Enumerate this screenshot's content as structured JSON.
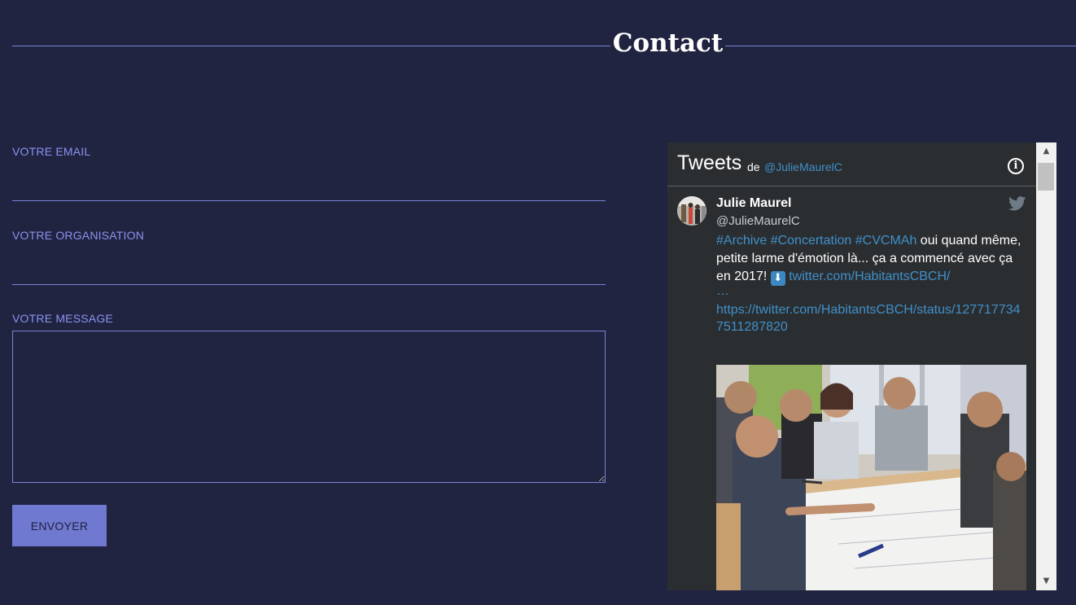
{
  "section": {
    "title": "Contact"
  },
  "form": {
    "email_label": "VOTRE EMAIL",
    "email_value": "",
    "organisation_label": "VOTRE ORGANISATION",
    "organisation_value": "",
    "message_label": "VOTRE MESSAGE",
    "message_value": "",
    "submit_label": "ENVOYER"
  },
  "twitter": {
    "title": "Tweets",
    "de": "de",
    "account_link": "@JulieMaurelC",
    "info_icon": "info-icon",
    "tweet": {
      "author_name": "Julie Maurel",
      "author_handle": "@JulieMaurelC",
      "bird_icon": "twitter-bird-icon",
      "tags": "#Archive #Concertation #CVCMAh",
      "text_part1": " oui quand même, petite larme d'émotion là... ça a commencé avec ça en 2017! ",
      "emoji": "⬇",
      "link_short": "twitter.com/HabitantsCBCH/",
      "ellipsis": "…",
      "status_link": "https://twitter.com/HabitantsCBCH/status/1277177347511287820"
    },
    "scrollbar": {
      "up_arrow": "▲",
      "down_arrow": "▼"
    }
  },
  "colors": {
    "background": "#212440",
    "accent": "#7a82d6",
    "label": "#8a92f0",
    "button": "#6f79cf",
    "widget_bg": "#2b2e31",
    "tweet_link": "#3f90c9"
  }
}
